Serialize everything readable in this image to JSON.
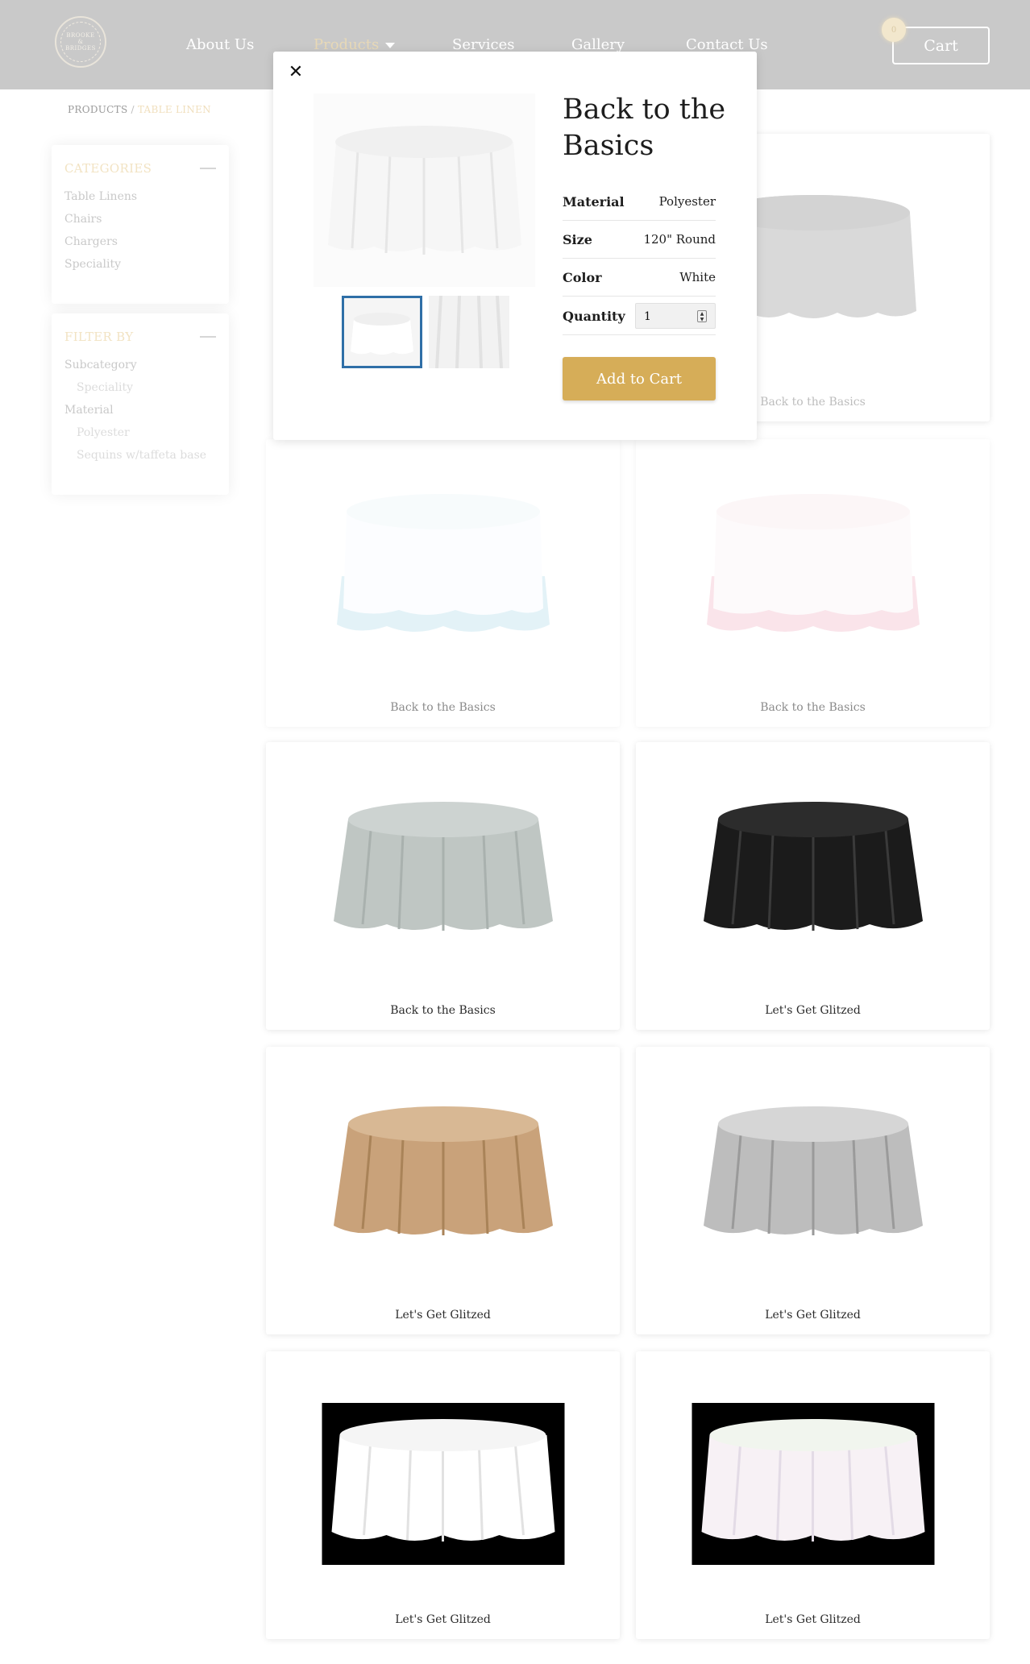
{
  "header": {
    "logo_text": "BROOKE & BRIDGES",
    "nav": [
      {
        "label": "About Us"
      },
      {
        "label": "Products"
      },
      {
        "label": "Services"
      },
      {
        "label": "Gallery"
      },
      {
        "label": "Contact Us"
      }
    ],
    "cart_label": "Cart",
    "cart_count": "0"
  },
  "breadcrumb": {
    "root": "PRODUCTS",
    "separator": "/",
    "current": "TABLE LINEN"
  },
  "sidebar": {
    "categories": {
      "title": "CATEGORIES",
      "items": [
        "Table Linens",
        "Chairs",
        "Chargers",
        "Speciality"
      ]
    },
    "filter": {
      "title": "FILTER BY",
      "groups": [
        {
          "label": "Subcategory",
          "options": [
            "Speciality"
          ]
        },
        {
          "label": "Material",
          "options": [
            "Polyester",
            "Sequins w/taffeta base"
          ]
        }
      ]
    }
  },
  "products": [
    {
      "name": "Back to the Basics",
      "cloth_color": "#d9d9d9"
    },
    {
      "name": "Back to the Basics",
      "cloth_color": "#fafdff",
      "skirt_color": "#cde9f2"
    },
    {
      "name": "Back to the Basics",
      "cloth_color": "#fdf7f8",
      "skirt_color": "#f6cfd9"
    },
    {
      "name": "Back to the Basics",
      "cloth_color": "#bfc6c3"
    },
    {
      "name": "Let's Get Glitzed",
      "cloth_color": "#1b1b1b"
    },
    {
      "name": "Let's Get Glitzed",
      "cloth_color": "#c9a27a"
    },
    {
      "name": "Let's Get Glitzed",
      "cloth_color": "#bdbdbd"
    },
    {
      "name": "Let's Get Glitzed",
      "cloth_color": "#ffffff"
    },
    {
      "name": "Let's Get Glitzed",
      "cloth_color": "#f7f1f5"
    }
  ],
  "modal": {
    "close_icon": "close-icon",
    "title": "Back to the Basics",
    "specs": [
      {
        "key": "Material",
        "value": "Polyester"
      },
      {
        "key": "Size",
        "value": "120\" Round"
      },
      {
        "key": "Color",
        "value": "White"
      }
    ],
    "quantity_label": "Quantity",
    "quantity_value": "1",
    "add_to_cart_label": "Add to Cart",
    "accent_color": "#d6ad58",
    "thumb_selected_color": "#2f6fa7"
  }
}
